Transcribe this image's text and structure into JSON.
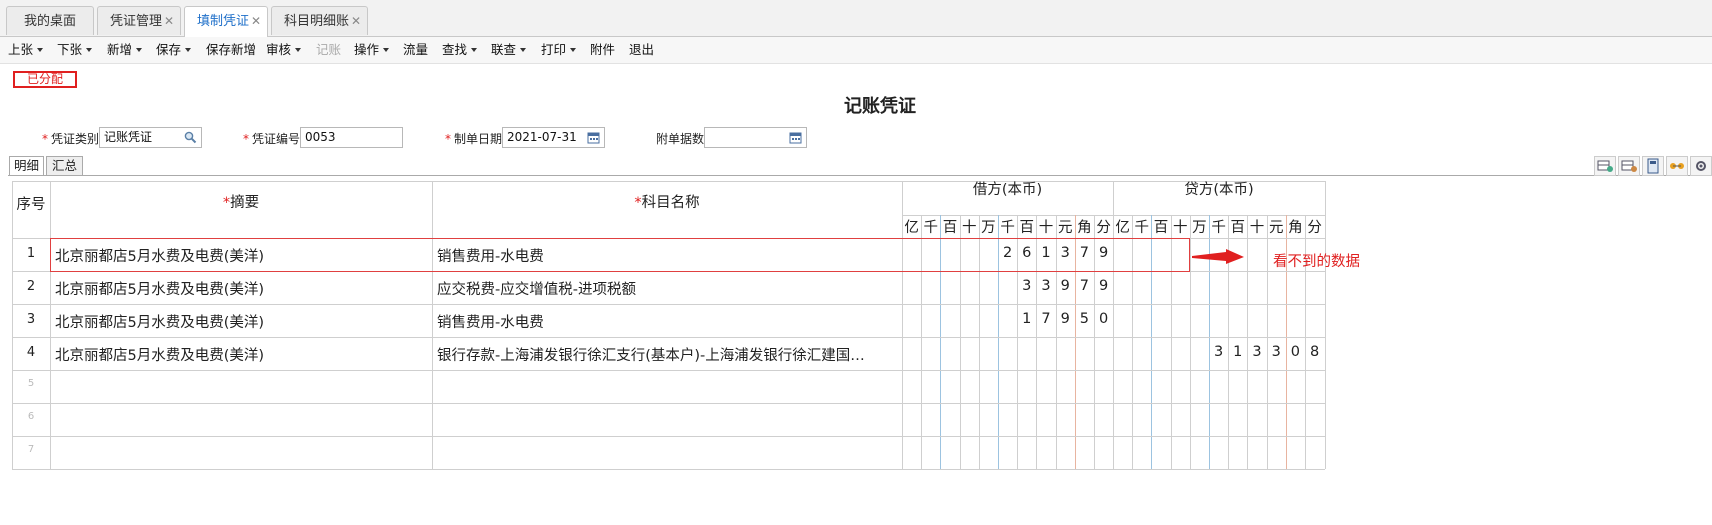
{
  "tabs": [
    {
      "label": "我的桌面",
      "closable": false,
      "active": false
    },
    {
      "label": "凭证管理",
      "closable": true,
      "active": false
    },
    {
      "label": "填制凭证",
      "closable": true,
      "active": true
    },
    {
      "label": "科目明细账",
      "closable": true,
      "active": false
    }
  ],
  "toolbar": [
    {
      "label": "上张",
      "dropdown": true,
      "enabled": true
    },
    {
      "label": "下张",
      "dropdown": true,
      "enabled": true
    },
    {
      "label": "新增",
      "dropdown": true,
      "enabled": true
    },
    {
      "label": "保存",
      "dropdown": true,
      "enabled": true
    },
    {
      "label": "保存新增",
      "dropdown": false,
      "enabled": true
    },
    {
      "label": "审核",
      "dropdown": true,
      "enabled": true
    },
    {
      "label": "记账",
      "dropdown": false,
      "enabled": false
    },
    {
      "label": "操作",
      "dropdown": true,
      "enabled": true
    },
    {
      "label": "流量",
      "dropdown": false,
      "enabled": true
    },
    {
      "label": "查找",
      "dropdown": true,
      "enabled": true
    },
    {
      "label": "联查",
      "dropdown": true,
      "enabled": true
    },
    {
      "label": "打印",
      "dropdown": true,
      "enabled": true
    },
    {
      "label": "附件",
      "dropdown": false,
      "enabled": true
    },
    {
      "label": "退出",
      "dropdown": false,
      "enabled": true
    }
  ],
  "status_badge": "已分配",
  "voucher_title": "记账凭证",
  "form": {
    "category_label": "凭证类别",
    "category_value": "记账凭证",
    "number_label": "凭证编号",
    "number_value": "0053",
    "date_label": "制单日期",
    "date_value": "2021-07-31",
    "attach_label": "附单据数",
    "attach_value": ""
  },
  "subtabs": [
    "明细",
    "汇总"
  ],
  "grid": {
    "seq_header": "序号",
    "summary_header": "摘要",
    "account_header": "科目名称",
    "req_mark": "*",
    "debit_header": "借方(本币)",
    "credit_header": "贷方(本币)",
    "units": [
      "亿",
      "千",
      "百",
      "十",
      "万",
      "千",
      "百",
      "十",
      "元",
      "角",
      "分"
    ],
    "rows": [
      {
        "no": "1",
        "summary": "北京丽都店5月水费及电费(美洋)",
        "account": "销售费用-水电费",
        "debit": "261379",
        "credit": ""
      },
      {
        "no": "2",
        "summary": "北京丽都店5月水费及电费(美洋)",
        "account": "应交税费-应交增值税-进项税额",
        "debit": "33979",
        "credit": ""
      },
      {
        "no": "3",
        "summary": "北京丽都店5月水费及电费(美洋)",
        "account": "销售费用-水电费",
        "debit": "17950",
        "credit": ""
      },
      {
        "no": "4",
        "summary": "北京丽都店5月水费及电费(美洋)",
        "account": "银行存款-上海浦发银行徐汇支行(基本户)-上海浦发银行徐汇建国…",
        "debit": "",
        "credit": "313308"
      },
      {
        "no": "5",
        "summary": "",
        "account": "",
        "debit": "",
        "credit": ""
      },
      {
        "no": "6",
        "summary": "",
        "account": "",
        "debit": "",
        "credit": ""
      },
      {
        "no": "7",
        "summary": "",
        "account": "",
        "debit": "",
        "credit": ""
      }
    ]
  },
  "annotation": "看不到的数据",
  "colors": {
    "accent": "#1e6fc9",
    "alert": "#e02020"
  },
  "icons": [
    "search-icon",
    "calendar-icon",
    "arrow-right-icon"
  ]
}
